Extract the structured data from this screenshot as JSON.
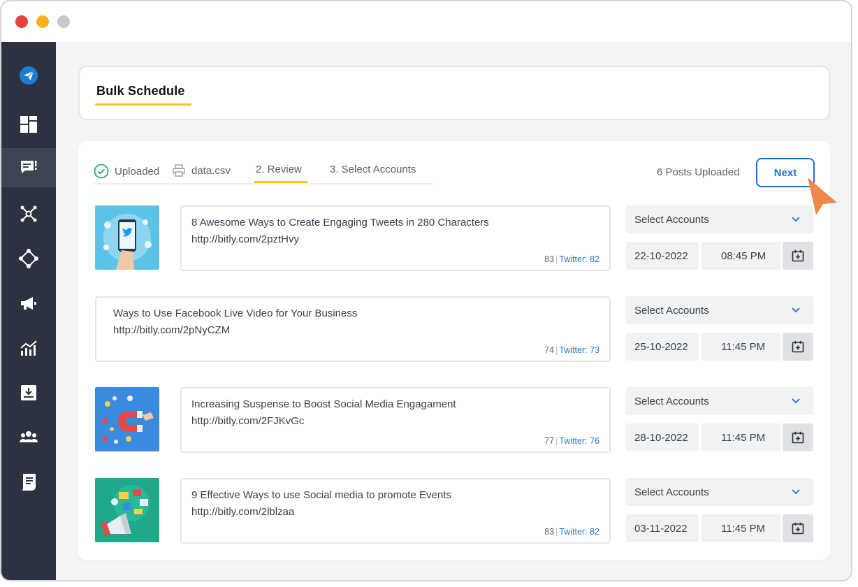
{
  "window": {
    "controls": [
      "close",
      "minimize",
      "zoom"
    ]
  },
  "sidebar": {
    "items": [
      {
        "icon": "paper-plane-icon"
      },
      {
        "icon": "dashboard-icon"
      },
      {
        "icon": "posts-icon",
        "active": true
      },
      {
        "icon": "network-icon"
      },
      {
        "icon": "connect-icon"
      },
      {
        "icon": "megaphone-icon"
      },
      {
        "icon": "analytics-icon"
      },
      {
        "icon": "download-icon"
      },
      {
        "icon": "team-icon"
      },
      {
        "icon": "reports-icon"
      }
    ]
  },
  "header": {
    "title": "Bulk Schedule"
  },
  "steps": {
    "uploaded_label": "Uploaded",
    "file_name": "data.csv",
    "review_label": "2. Review",
    "select_accounts_label": "3. Select Accounts"
  },
  "status": {
    "posts_uploaded": "6 Posts Uploaded"
  },
  "actions": {
    "next_label": "Next"
  },
  "colors": {
    "accent_blue": "#1f6fd1",
    "highlight_yellow": "#f5c518",
    "sidebar_bg": "#2c323f",
    "cursor_orange": "#f0884a"
  },
  "posts": [
    {
      "title": "8 Awesome Ways to Create Engaging Tweets in 280 Characters",
      "link": "http://bitly.com/2pztHvy",
      "count": "83",
      "twitter": "Twitter: 82",
      "select_placeholder": "Select Accounts",
      "date": "22-10-2022",
      "time": "08:45 PM",
      "thumbnail": "twitter-phone-illustration"
    },
    {
      "title": "Ways to Use Facebook Live Video for Your Business",
      "link": "http://bitly.com/2pNyCZM",
      "count": "74",
      "twitter": "Twitter: 73",
      "select_placeholder": "Select Accounts",
      "date": "25-10-2022",
      "time": "11:45 PM",
      "thumbnail": null
    },
    {
      "title": "Increasing Suspense to Boost Social Media Engagament",
      "link": "http://bitly.com/2FJKvGc",
      "count": "77",
      "twitter": "Twitter: 76",
      "select_placeholder": "Select Accounts",
      "date": "28-10-2022",
      "time": "11:45 PM",
      "thumbnail": "magnet-engagement-illustration"
    },
    {
      "title": "9 Effective Ways to use Social media to promote Events",
      "link": "http://bitly.com/2lblzaa",
      "count": "83",
      "twitter": "Twitter: 82",
      "select_placeholder": "Select Accounts",
      "date": "03-11-2022",
      "time": "11:45 PM",
      "thumbnail": "megaphone-events-illustration"
    }
  ]
}
